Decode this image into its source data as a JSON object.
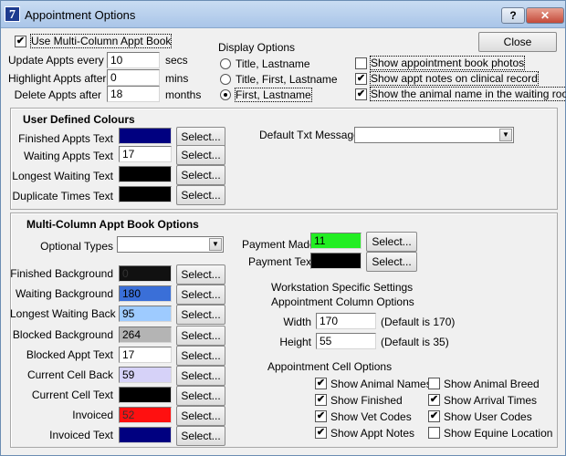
{
  "window": {
    "title": "Appointment Options",
    "app_icon": "7",
    "help_glyph": "?",
    "close_glyph": "✕"
  },
  "top": {
    "multi_column_label": "Use Multi-Column Appt Book",
    "multi_column_checked": true,
    "update_label": "Update Appts every",
    "update_value": "10",
    "update_unit": "secs",
    "highlight_label": "Highlight Appts after",
    "highlight_value": "0",
    "highlight_unit": "mins",
    "delete_label": "Delete Appts after",
    "delete_value": "18",
    "delete_unit": "months",
    "close_label": "Close"
  },
  "display_options": {
    "title": "Display Options",
    "options": [
      "Title, Lastname",
      "Title, First, Lastname",
      "First, Lastname"
    ],
    "selected_index": 2
  },
  "show_options": [
    {
      "label": "Show appointment book photos",
      "checked": false
    },
    {
      "label": "Show appt notes on clinical record",
      "checked": true
    },
    {
      "label": "Show the animal name in the waiting room",
      "checked": true
    }
  ],
  "user_colours": {
    "title": "User Defined Colours",
    "rows": [
      {
        "label": "Finished Appts Text",
        "value": "",
        "color": "#000080"
      },
      {
        "label": "Waiting Appts Text",
        "value": "17",
        "color": "#ffffff"
      },
      {
        "label": "Longest Waiting Text",
        "value": "",
        "color": "#000000"
      },
      {
        "label": "Duplicate Times Text",
        "value": "",
        "color": "#000000"
      }
    ],
    "select_label": "Select...",
    "default_txt_label": "Default Txt Message",
    "default_txt_value": ""
  },
  "multi_column": {
    "title": "Multi-Column Appt Book Options",
    "optional_types_label": "Optional Types",
    "optional_types_value": "",
    "rows": [
      {
        "label": "Finished Background",
        "value": "0",
        "color": "#111111",
        "text_color": "#333333"
      },
      {
        "label": "Waiting Background",
        "value": "180",
        "color": "#3a6fd8",
        "text_color": "#000000"
      },
      {
        "label": "Longest Waiting Back",
        "value": "95",
        "color": "#9ecbff",
        "text_color": "#000000"
      },
      {
        "label": "Blocked Background",
        "value": "264",
        "color": "#b4b4b4",
        "text_color": "#000000"
      },
      {
        "label": "Blocked Appt Text",
        "value": "17",
        "color": "#ffffff",
        "text_color": "#000000"
      },
      {
        "label": "Current Cell Back",
        "value": "59",
        "color": "#d6d2f8",
        "text_color": "#000000"
      },
      {
        "label": "Current Cell Text",
        "value": "",
        "color": "#000000",
        "text_color": "#000000"
      },
      {
        "label": "Invoiced",
        "value": "52",
        "color": "#ff1010",
        "text_color": "#333333"
      },
      {
        "label": "Invoiced Text",
        "value": "",
        "color": "#000080",
        "text_color": "#000000"
      }
    ],
    "payment_made_label": "Payment Made",
    "payment_made_value": "11",
    "payment_made_color": "#22ee22",
    "payment_text_label": "Payment Text",
    "payment_text_value": "",
    "payment_text_color": "#000000",
    "select_label": "Select..."
  },
  "workstation": {
    "title_line1": "Workstation Specific Settings",
    "title_line2": "Appointment Column Options",
    "width_label": "Width",
    "width_value": "170",
    "width_default": "(Default is 170)",
    "height_label": "Height",
    "height_value": "55",
    "height_default": "(Default is 35)"
  },
  "cell_options": {
    "title": "Appointment Cell Options",
    "items": [
      {
        "label": "Show Animal Names",
        "checked": true
      },
      {
        "label": "Show Animal Breed",
        "checked": false
      },
      {
        "label": "Show Finished",
        "checked": true
      },
      {
        "label": "Show Arrival Times",
        "checked": true
      },
      {
        "label": "Show Vet Codes",
        "checked": true
      },
      {
        "label": "Show User Codes",
        "checked": true
      },
      {
        "label": "Show Appt Notes",
        "checked": true
      },
      {
        "label": "Show Equine Location",
        "checked": false
      }
    ]
  }
}
